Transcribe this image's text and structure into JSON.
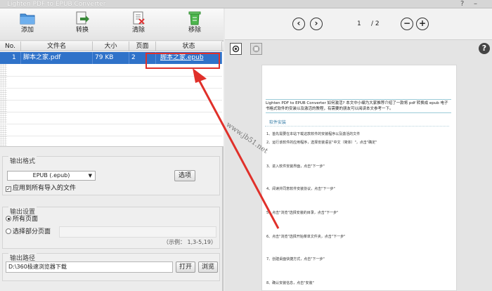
{
  "window": {
    "title": "Lighten PDF to EPUB Converter",
    "help": "?",
    "minimize": "–"
  },
  "toolbar": {
    "add": "添加",
    "convert": "转换",
    "clear": "清除",
    "remove": "移除"
  },
  "table": {
    "headers": [
      "No.",
      "文件名",
      "大小",
      "页面",
      "状态"
    ],
    "rows": [
      {
        "no": "1",
        "name": "脚本之家.pdf",
        "size": "79 KB",
        "pages": "2",
        "status": "脚本之家.epub"
      }
    ]
  },
  "output_format": {
    "title": "输出格式",
    "selected": "EPUB (.epub)",
    "options_btn": "选项",
    "apply_all": "应用到所有导入的文件"
  },
  "output_settings": {
    "title": "输出设置",
    "all_pages": "所有页面",
    "select_pages": "选择部分页面",
    "example": "（示例： 1,3-5,19）"
  },
  "output_path": {
    "title": "输出路径",
    "path": "D:\\360极速浏览器下载",
    "open_btn": "打开",
    "browse_btn": "浏览"
  },
  "preview": {
    "page": "1",
    "total": "/ 2",
    "help": "?",
    "intro": "Lighten PDF to EPUB Converter 如何激活? 本文中小编为大家推荐介绍了一款将 pdf 转换成 epub 电子书格式软件的安装以及激活的教程，有需要的朋友可以阅读本文参考一下。",
    "section": "软件安装",
    "steps": [
      "1、首先需要在本站下载这款软件的安装程序以及激活的文件",
      "2、运行该软件的应用程序，选择安装语言\"中文（简体）\"，点击\"确定\"",
      "3、进入软件安装界面，点击\"下一步\"",
      "4、阅读并同意软件安装协议，点击\"下一步\"",
      "5、点击\"浏览\"选择安装的目录，点击\"下一步\"",
      "6、点击\"浏览\"选择开始菜单文件夹，点击\"下一步\"",
      "7、创建桌面快捷方式，点击\"下一步\"",
      "8、确认安装信息，点击\"安装\""
    ]
  },
  "watermark": "www.jb51.net",
  "colors": {
    "selection": "#2f72c9",
    "highlight_box": "#e0302a",
    "arrow": "#e0302a"
  }
}
